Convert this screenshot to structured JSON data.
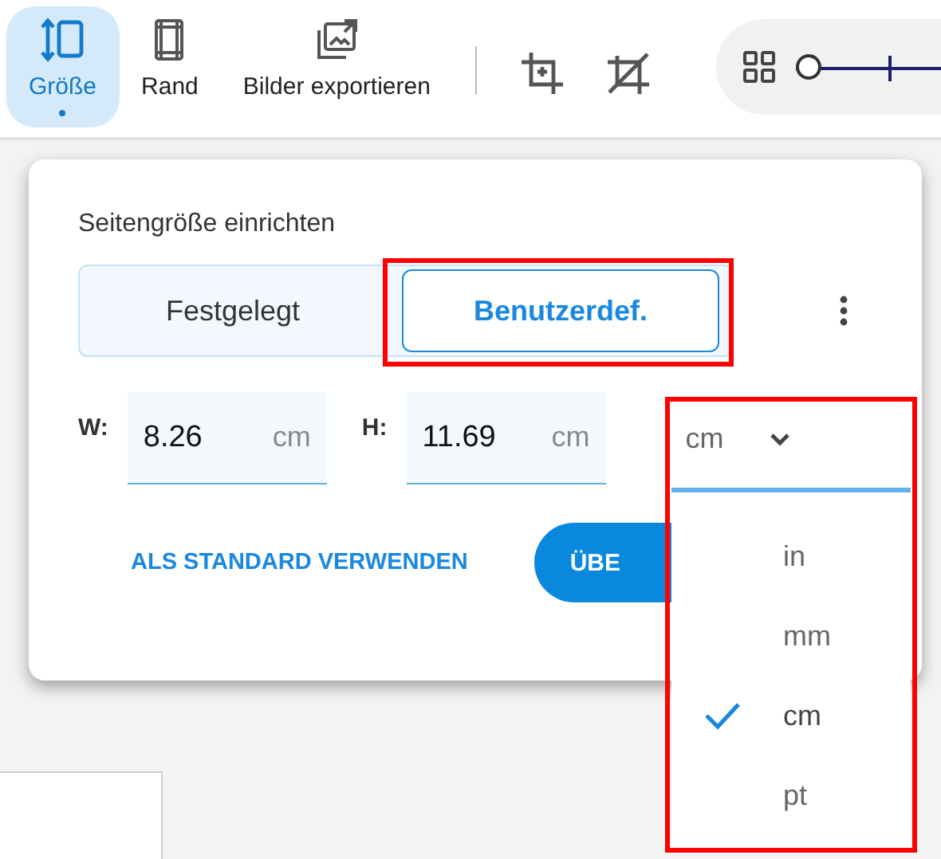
{
  "toolbar": {
    "buttons": [
      {
        "label": "Größe",
        "selected": true
      },
      {
        "label": "Rand",
        "selected": false
      },
      {
        "label": "Bilder exportieren",
        "selected": false
      }
    ],
    "zoom": {
      "level": 0
    }
  },
  "dialog": {
    "title": "Seitengröße einrichten",
    "segments": [
      {
        "label": "Festgelegt",
        "selected": false
      },
      {
        "label": "Benutzerdef.",
        "selected": true
      }
    ],
    "fields": [
      {
        "label": "W:",
        "value": "8.26",
        "unit": "cm"
      },
      {
        "label": "H:",
        "value": "11.69",
        "unit": "cm"
      }
    ],
    "unit_select": {
      "value": "cm",
      "expanded": true
    },
    "link": "ALS STANDARD VERWENDEN",
    "primary_button": "ÜBE"
  },
  "unit_menu": [
    {
      "label": "in",
      "selected": false
    },
    {
      "label": "mm",
      "selected": false
    },
    {
      "label": "cm",
      "selected": true
    },
    {
      "label": "pt",
      "selected": false
    }
  ]
}
